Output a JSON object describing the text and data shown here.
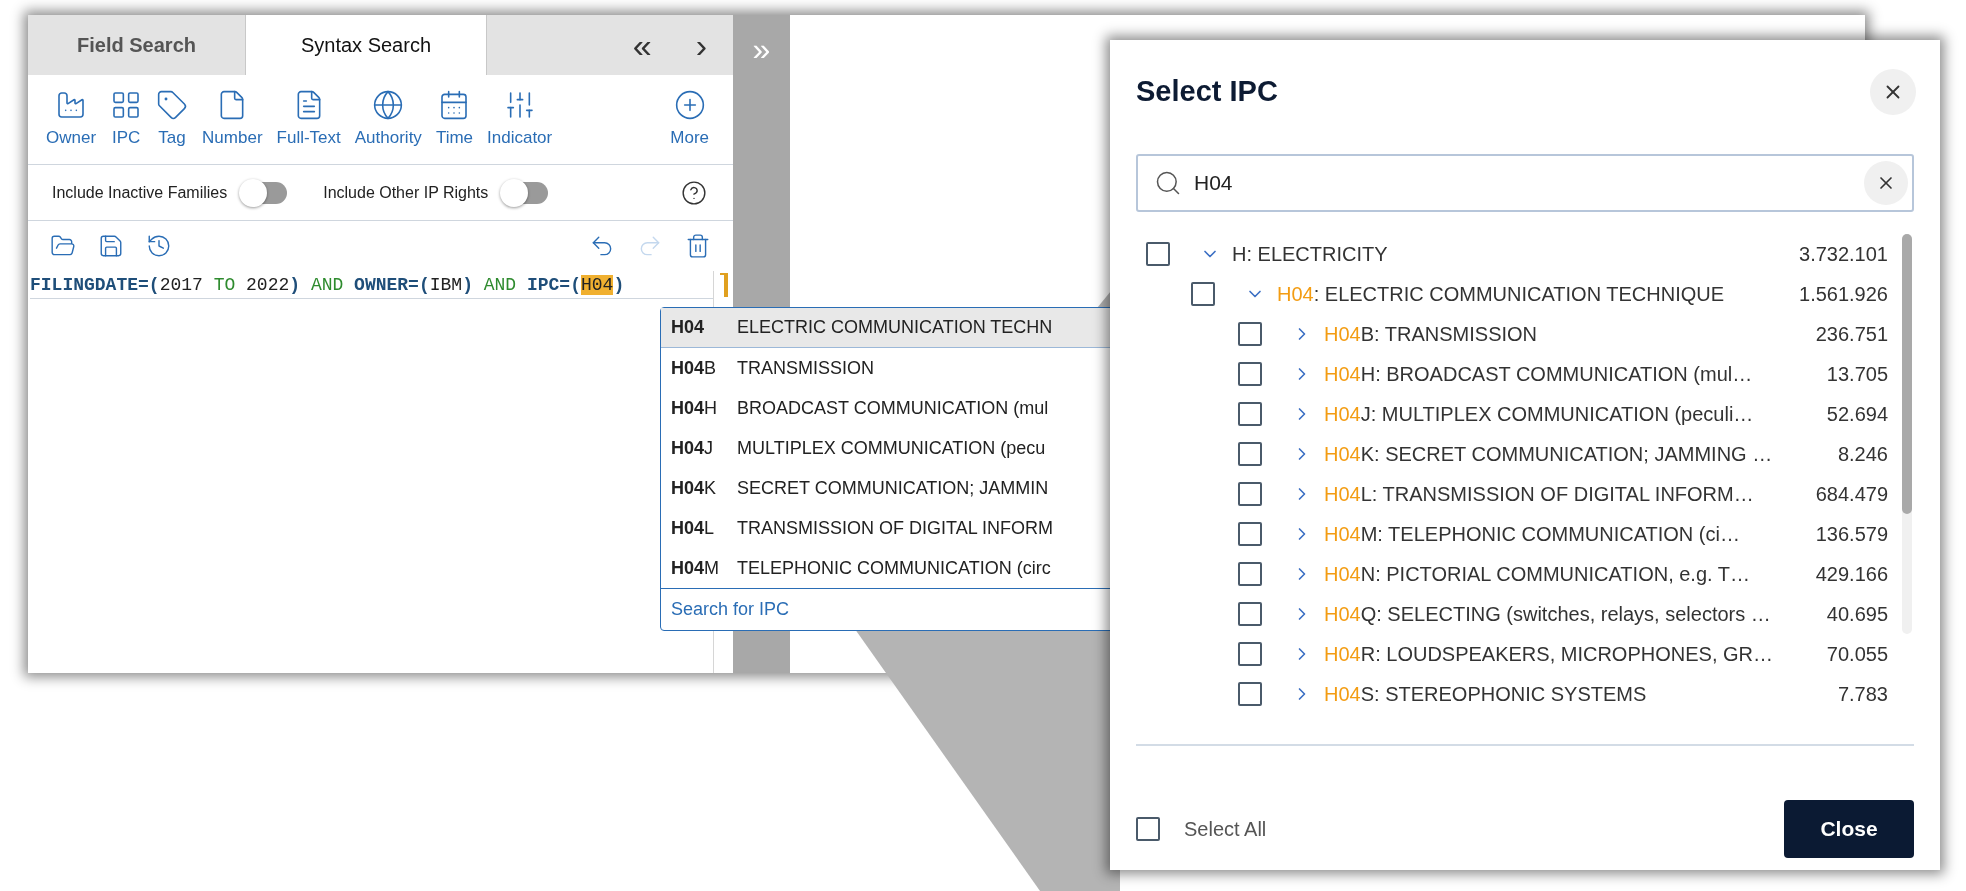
{
  "tabs": [
    {
      "label": "Field Search",
      "selected": false
    },
    {
      "label": "Syntax Search",
      "selected": true
    }
  ],
  "tab_nav": {
    "back": "«",
    "forward": "›"
  },
  "side_toggle": "»",
  "toolbar": [
    {
      "label": "Owner"
    },
    {
      "label": "IPC"
    },
    {
      "label": "Tag"
    },
    {
      "label": "Number"
    },
    {
      "label": "Full-Text"
    },
    {
      "label": "Authority"
    },
    {
      "label": "Time"
    },
    {
      "label": "Indicator"
    },
    {
      "label": "More"
    }
  ],
  "options": [
    {
      "label": "Include Inactive Families",
      "on": false
    },
    {
      "label": "Include Other IP Rights",
      "on": false
    }
  ],
  "actions": [
    {
      "disabled": false
    },
    {
      "disabled": false
    },
    {
      "disabled": false
    },
    {
      "disabled": false
    },
    {
      "disabled": true
    },
    {
      "disabled": false
    }
  ],
  "query": [
    {
      "kind": "field",
      "text": "FILINGDATE=("
    },
    {
      "kind": "value",
      "text": "2017 "
    },
    {
      "kind": "operator",
      "text": "TO "
    },
    {
      "kind": "value",
      "text": "2022"
    },
    {
      "kind": "field",
      "text": ") "
    },
    {
      "kind": "operator",
      "text": "AND "
    },
    {
      "kind": "field",
      "text": "OWNER=("
    },
    {
      "kind": "value",
      "text": "IBM"
    },
    {
      "kind": "field",
      "text": ") "
    },
    {
      "kind": "operator",
      "text": "AND "
    },
    {
      "kind": "field",
      "text": "IPC=("
    },
    {
      "kind": "match",
      "text": "H04"
    },
    {
      "kind": "field",
      "text": ")"
    }
  ],
  "suggestions": {
    "items": [
      {
        "code": "H04",
        "title": "ELECTRIC COMMUNICATION TECHN",
        "selected": true
      },
      {
        "code": "H04",
        "suffix": "B",
        "title": "TRANSMISSION",
        "selected": false
      },
      {
        "code": "H04",
        "suffix": "H",
        "title": "BROADCAST COMMUNICATION (mul",
        "selected": false
      },
      {
        "code": "H04",
        "suffix": "J",
        "title": "MULTIPLEX COMMUNICATION (pecu",
        "selected": false
      },
      {
        "code": "H04",
        "suffix": "K",
        "title": "SECRET COMMUNICATION; JAMMIN",
        "selected": false
      },
      {
        "code": "H04",
        "suffix": "L",
        "title": "TRANSMISSION OF DIGITAL INFORM",
        "selected": false
      },
      {
        "code": "H04",
        "suffix": "M",
        "title": "TELEPHONIC COMMUNICATION (circ",
        "selected": false
      }
    ],
    "link": "Search for IPC"
  },
  "dialog": {
    "title": "Select IPC",
    "search": {
      "value": "H04"
    },
    "tree": [
      {
        "label": "H: ELECTRICITY",
        "count": "3.732.101",
        "checked": false,
        "expanded": true,
        "children": [
          {
            "match": "H04",
            "label": ": ELECTRIC COMMUNICATION TECHNIQUE",
            "count": "1.561.926",
            "checked": false,
            "expanded": true,
            "children": [
              {
                "match": "H04",
                "label": "B: TRANSMISSION",
                "count": "236.751",
                "checked": false,
                "expanded": false
              },
              {
                "match": "H04",
                "label": "H: BROADCAST COMMUNICATION (mul…",
                "count": "13.705",
                "checked": false,
                "expanded": false
              },
              {
                "match": "H04",
                "label": "J: MULTIPLEX COMMUNICATION (peculi…",
                "count": "52.694",
                "checked": false,
                "expanded": false
              },
              {
                "match": "H04",
                "label": "K: SECRET COMMUNICATION; JAMMING …",
                "count": "8.246",
                "checked": false,
                "expanded": false
              },
              {
                "match": "H04",
                "label": "L: TRANSMISSION OF DIGITAL INFORM…",
                "count": "684.479",
                "checked": false,
                "expanded": false
              },
              {
                "match": "H04",
                "label": "M: TELEPHONIC COMMUNICATION (ci…",
                "count": "136.579",
                "checked": false,
                "expanded": false
              },
              {
                "match": "H04",
                "label": "N: PICTORIAL COMMUNICATION, e.g. T…",
                "count": "429.166",
                "checked": false,
                "expanded": false
              },
              {
                "match": "H04",
                "label": "Q: SELECTING (switches, relays, selectors …",
                "count": "40.695",
                "checked": false,
                "expanded": false
              },
              {
                "match": "H04",
                "label": "R: LOUDSPEAKERS, MICROPHONES, GR…",
                "count": "70.055",
                "checked": false,
                "expanded": false
              },
              {
                "match": "H04",
                "label": "S: STEREOPHONIC SYSTEMS",
                "count": "7.783",
                "checked": false,
                "expanded": false
              }
            ]
          }
        ]
      }
    ],
    "select_all": {
      "label": "Select All",
      "checked": false
    },
    "close_button": "Close"
  }
}
